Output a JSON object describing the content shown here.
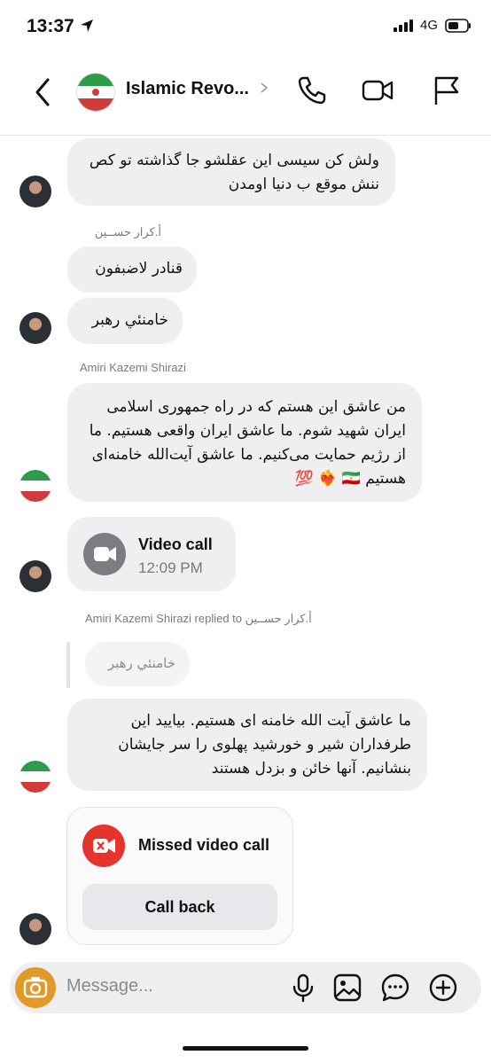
{
  "status": {
    "time": "13:37",
    "network": "4G"
  },
  "header": {
    "title": "Islamic Revo..."
  },
  "messages": {
    "m1": "ولش کن سیسی این عقلشو جا گذاشته تو کص ننش موقع ب دنیا اومدن",
    "sender2": "أ.كرار حســين",
    "m2": "قنادر لاضبفون",
    "m3": "خامنئي رهبر",
    "sender3": "Amiri Kazemi Shirazi",
    "m4": "من عاشق این هستم که در راه جمهوری اسلامی ایران شهید شوم. ما عاشق ایران واقعی هستیم. ما از رژیم حمایت می‌کنیم. ما عاشق آیت‌الله خامنه‌ای هستیم 🇮🇷 ❤️‍🔥 💯",
    "video_call_label": "Video call",
    "video_call_time": "12:09 PM",
    "reply_header": "Amiri Kazemi Shirazi replied to أ.كرار حســين",
    "reply_quote": "خامنئي رهبر",
    "m5": "ما عاشق آیت الله خامنه ای هستیم. بیایید این طرفداران شیر و خورشید پهلوی را سر جایشان بنشانیم. آنها خائن و بزدل هستند",
    "missed_call_label": "Missed video call",
    "callback_label": "Call back"
  },
  "composer": {
    "placeholder": "Message..."
  },
  "colors": {
    "accent_camera": "#e19a28",
    "missed_red": "#e5342b",
    "bubble": "#efeff2"
  }
}
